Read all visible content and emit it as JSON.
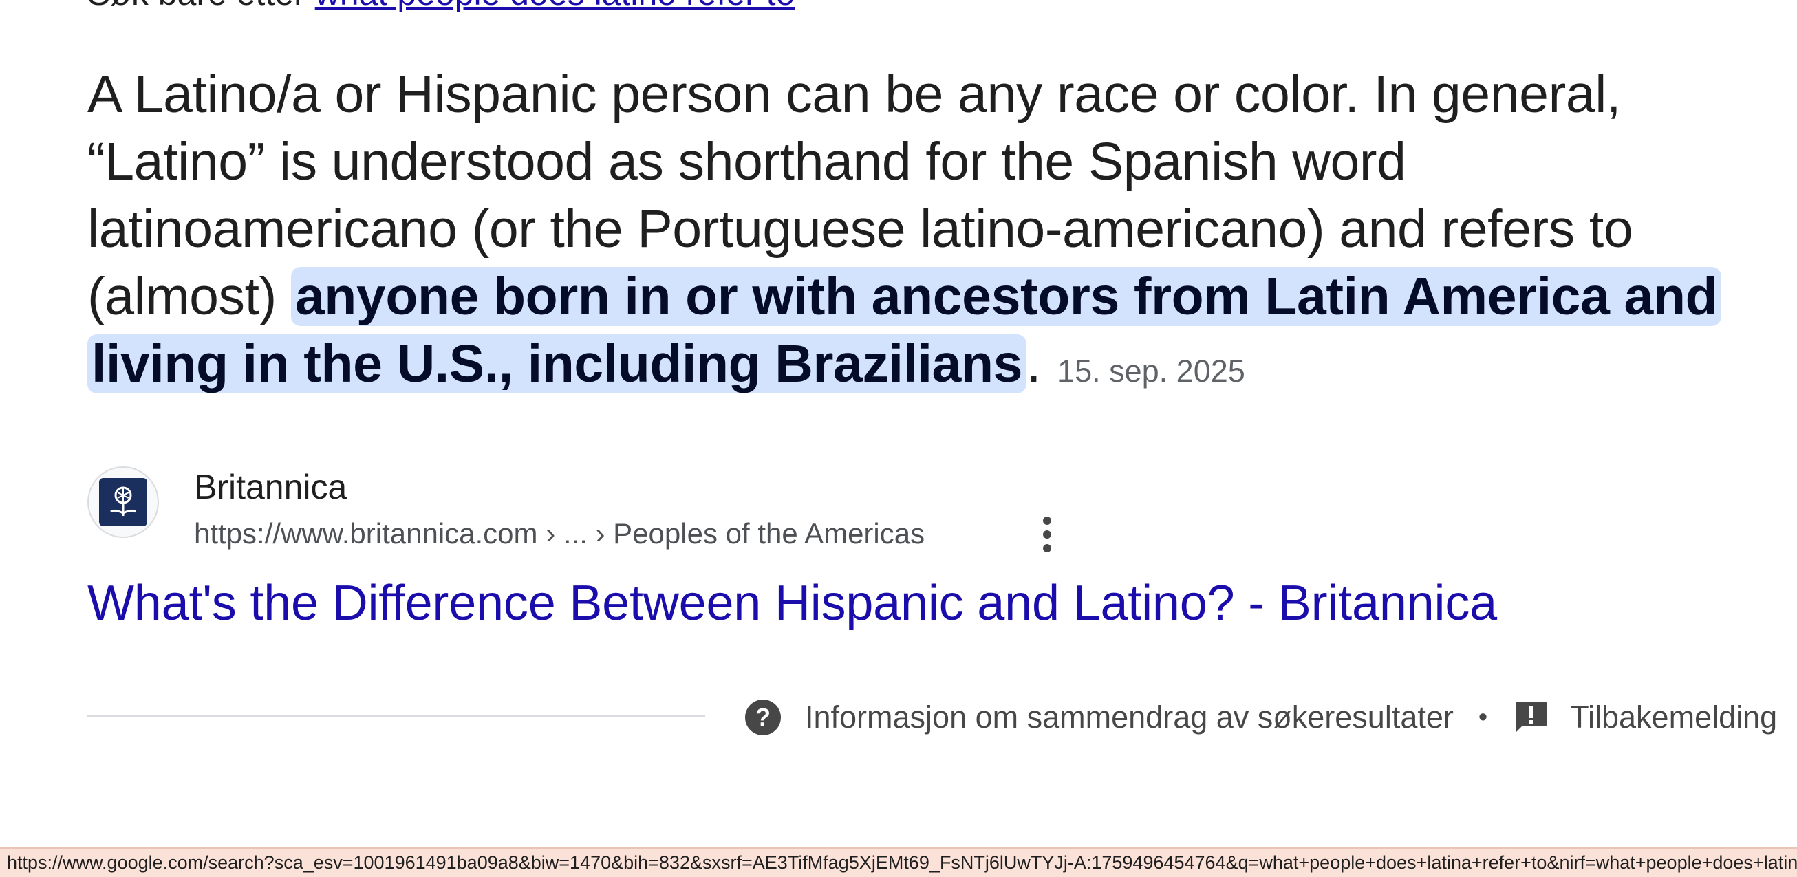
{
  "top": {
    "prefix": "Søk bare etter",
    "link": "what people does latino refer to"
  },
  "answer": {
    "text_before": "A Latino/a or Hispanic person can be any race or color. In general, “Latino” is understood as shorthand for the Spanish word latinoamericano (or the Portuguese latino-americano) and refers to (almost) ",
    "highlight": "anyone born in or with ancestors from Latin America and living in the U.S., including Brazilians",
    "text_after": ".",
    "date": "15. sep. 2025"
  },
  "source": {
    "name": "Britannica",
    "url": "https://www.britannica.com › ... › Peoples of the Americas",
    "favicon_icon": "britannica-thistle-icon",
    "menu_icon": "more-vert-icon"
  },
  "result": {
    "title": "What's the Difference Between Hispanic and Latino? - Britannica"
  },
  "footer": {
    "help_icon": "help-circle-icon",
    "info_label": "Informasjon om sammendrag av søkeresultater",
    "separator": "•",
    "feedback_icon": "feedback-icon",
    "feedback_label": "Tilbakemelding"
  },
  "status_bar": {
    "url": "https://www.google.com/search?sca_esv=1001961491ba09a8&biw=1470&bih=832&sxsrf=AE3TifMfag5XjEMt69_FsNTj6lUwTYJj-A:1759496454764&q=what+people+does+latina+refer+to&nirf=what+people+does+latino+refer+to&sa=X"
  },
  "colors": {
    "link": "#1a0dab",
    "highlight_bg": "#d3e3fd",
    "status_bar_bg": "#fbe2d9"
  }
}
